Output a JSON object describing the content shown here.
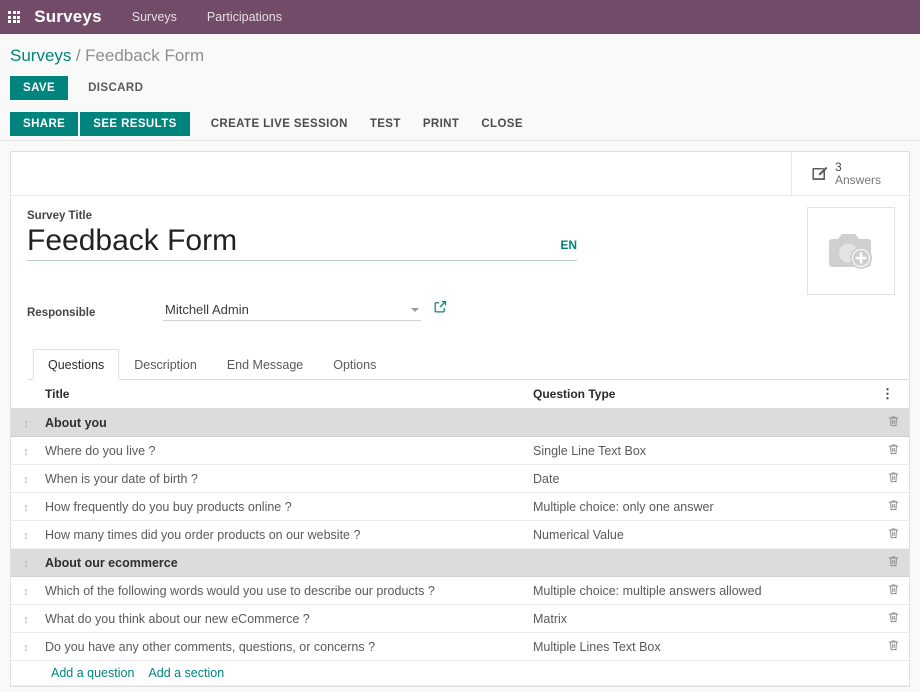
{
  "navbar": {
    "apps_icon": "grid-apps-icon",
    "brand": "Surveys",
    "items": [
      {
        "label": "Surveys"
      },
      {
        "label": "Participations"
      }
    ]
  },
  "breadcrumb": {
    "root": "Surveys",
    "separator": "/",
    "current": "Feedback Form"
  },
  "actions": {
    "save_label": "SAVE",
    "discard_label": "DISCARD"
  },
  "statusbar": {
    "buttons": [
      {
        "label": "SHARE",
        "style": "primary"
      },
      {
        "label": "SEE RESULTS",
        "style": "primary"
      },
      {
        "label": "CREATE LIVE SESSION",
        "style": "flat"
      },
      {
        "label": "TEST",
        "style": "flat"
      },
      {
        "label": "PRINT",
        "style": "flat"
      },
      {
        "label": "CLOSE",
        "style": "flat"
      }
    ]
  },
  "stat": {
    "icon": "pencil-square-icon",
    "value": "3",
    "label": "Answers"
  },
  "form": {
    "title_label": "Survey Title",
    "title_value": "Feedback Form",
    "title_placeholder": "e.g. Satisfaction Survey",
    "lang_badge": "EN",
    "responsible_label": "Responsible",
    "responsible_value": "Mitchell Admin",
    "photo_placeholder_icon": "camera-add-icon"
  },
  "tabs": [
    {
      "label": "Questions",
      "active": true
    },
    {
      "label": "Description",
      "active": false
    },
    {
      "label": "End Message",
      "active": false
    },
    {
      "label": "Options",
      "active": false
    }
  ],
  "table": {
    "columns": {
      "handle": "",
      "title": "Title",
      "type": "Question Type",
      "options_icon": "vertical-dots-icon"
    },
    "rows": [
      {
        "kind": "section",
        "title": "About you",
        "type": ""
      },
      {
        "kind": "question",
        "title": "Where do you live ?",
        "type": "Single Line Text Box"
      },
      {
        "kind": "question",
        "title": "When is your date of birth ?",
        "type": "Date"
      },
      {
        "kind": "question",
        "title": "How frequently do you buy products online ?",
        "type": "Multiple choice: only one answer"
      },
      {
        "kind": "question",
        "title": "How many times did you order products on our website ?",
        "type": "Numerical Value"
      },
      {
        "kind": "section",
        "title": "About our ecommerce",
        "type": ""
      },
      {
        "kind": "question",
        "title": "Which of the following words would you use to describe our products ?",
        "type": "Multiple choice: multiple answers allowed"
      },
      {
        "kind": "question",
        "title": "What do you think about our new eCommerce ?",
        "type": "Matrix"
      },
      {
        "kind": "question",
        "title": "Do you have any other comments, questions, or concerns ?",
        "type": "Multiple Lines Text Box"
      }
    ],
    "add_question_label": "Add a question",
    "add_section_label": "Add a section",
    "row_delete_icon": "trash-icon",
    "row_drag_icon": "drag-handle-icon"
  },
  "colors": {
    "navbar_purple": "#714B67",
    "accent_teal": "#00847E",
    "section_row_gray": "#dcdcdc"
  }
}
